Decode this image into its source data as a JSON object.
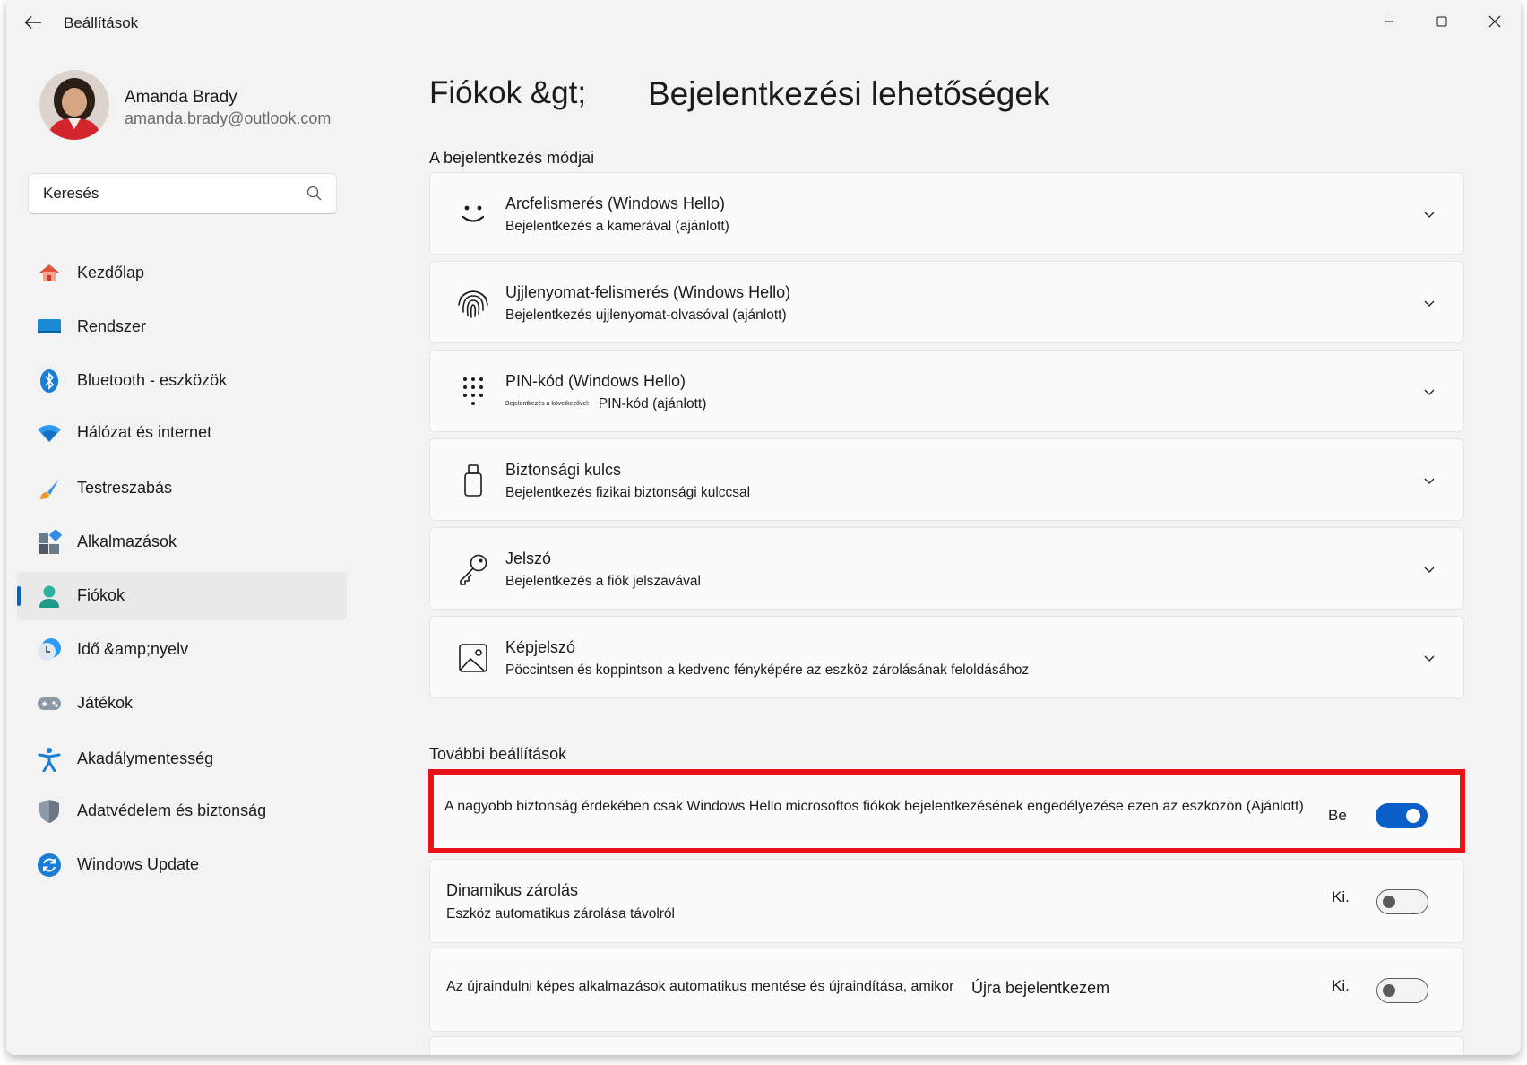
{
  "app": {
    "title": "Beállítások"
  },
  "user": {
    "name": "Amanda Brady",
    "email": "amanda.brady@outlook.com"
  },
  "search": {
    "placeholder": "Keresés"
  },
  "nav": [
    {
      "label": "Kezdőlap",
      "icon": "home-icon"
    },
    {
      "label": "Rendszer",
      "icon": "system-icon"
    },
    {
      "label": "Bluetooth - eszközök",
      "icon": "bluetooth-icon"
    },
    {
      "label": "Hálózat és internet",
      "icon": "wifi-icon"
    },
    {
      "label": "Testreszabás",
      "icon": "brush-icon"
    },
    {
      "label": "Alkalmazások",
      "icon": "apps-icon"
    },
    {
      "label": "Fiókok",
      "icon": "account-icon",
      "selected": true
    },
    {
      "label": "Idő &amp;nyelv",
      "icon": "time-language-icon"
    },
    {
      "label": "Játékok",
      "icon": "gamepad-icon"
    },
    {
      "label": "Akadálymentesség",
      "icon": "accessibility-icon"
    },
    {
      "label": "Adatvédelem és biztonság",
      "icon": "shield-icon"
    },
    {
      "label": "Windows Update",
      "icon": "update-icon"
    }
  ],
  "breadcrumb": {
    "parent": "Fiókok &gt;",
    "current": "Bejelentkezési lehetőségek"
  },
  "sections": {
    "signin_ways": "A bejelentkezés módjai",
    "additional": "További beállítások"
  },
  "signin_options": [
    {
      "title": "Arcfelismerés (Windows Hello)",
      "subtitle": "Bejelentkezés a kamerával (ajánlott)",
      "icon": "face-icon"
    },
    {
      "title": "Ujjlenyomat-felismerés (Windows Hello)",
      "subtitle": "Bejelentkezés ujjlenyomat-olvasóval (ajánlott)",
      "icon": "fingerprint-icon"
    },
    {
      "title": "PIN-kód (Windows Hello)",
      "subtitle_small": "Bejelentkezés a következővel:",
      "subtitle": "PIN-kód (ajánlott)",
      "icon": "pin-keypad-icon"
    },
    {
      "title": "Biztonsági kulcs",
      "subtitle": "Bejelentkezés fizikai biztonsági kulccsal",
      "icon": "usb-key-icon"
    },
    {
      "title": "Jelszó",
      "subtitle": "Bejelentkezés a fiók jelszavával",
      "icon": "key-icon"
    },
    {
      "title": "Képjelszó",
      "subtitle": "Pöccintsen és koppintson a kedvenc fényképére az eszköz zárolásának feloldásához",
      "icon": "picture-icon"
    }
  ],
  "additional_settings": {
    "hello_only": {
      "text": "A nagyobb biztonság érdekében csak Windows Hello microsoftos fiókok bejelentkezésének engedélyezése ezen az eszközön (Ajánlott)",
      "state": "Be",
      "on": true
    },
    "dynamic_lock": {
      "title": "Dinamikus zárolás",
      "subtitle": "Eszköz automatikus zárolása távolról",
      "state": "Ki.",
      "on": false
    },
    "restart_apps": {
      "text": "Az újraindulni képes alkalmazások automatikus mentése és újraindítása, amikor",
      "extra": "Újra bejelentkezem",
      "state": "Ki.",
      "on": false
    }
  },
  "colors": {
    "accent": "#0a5ec7",
    "highlight_border": "#e81219",
    "window_bg": "#f3f3f3",
    "card_bg": "#fbfbfb"
  }
}
